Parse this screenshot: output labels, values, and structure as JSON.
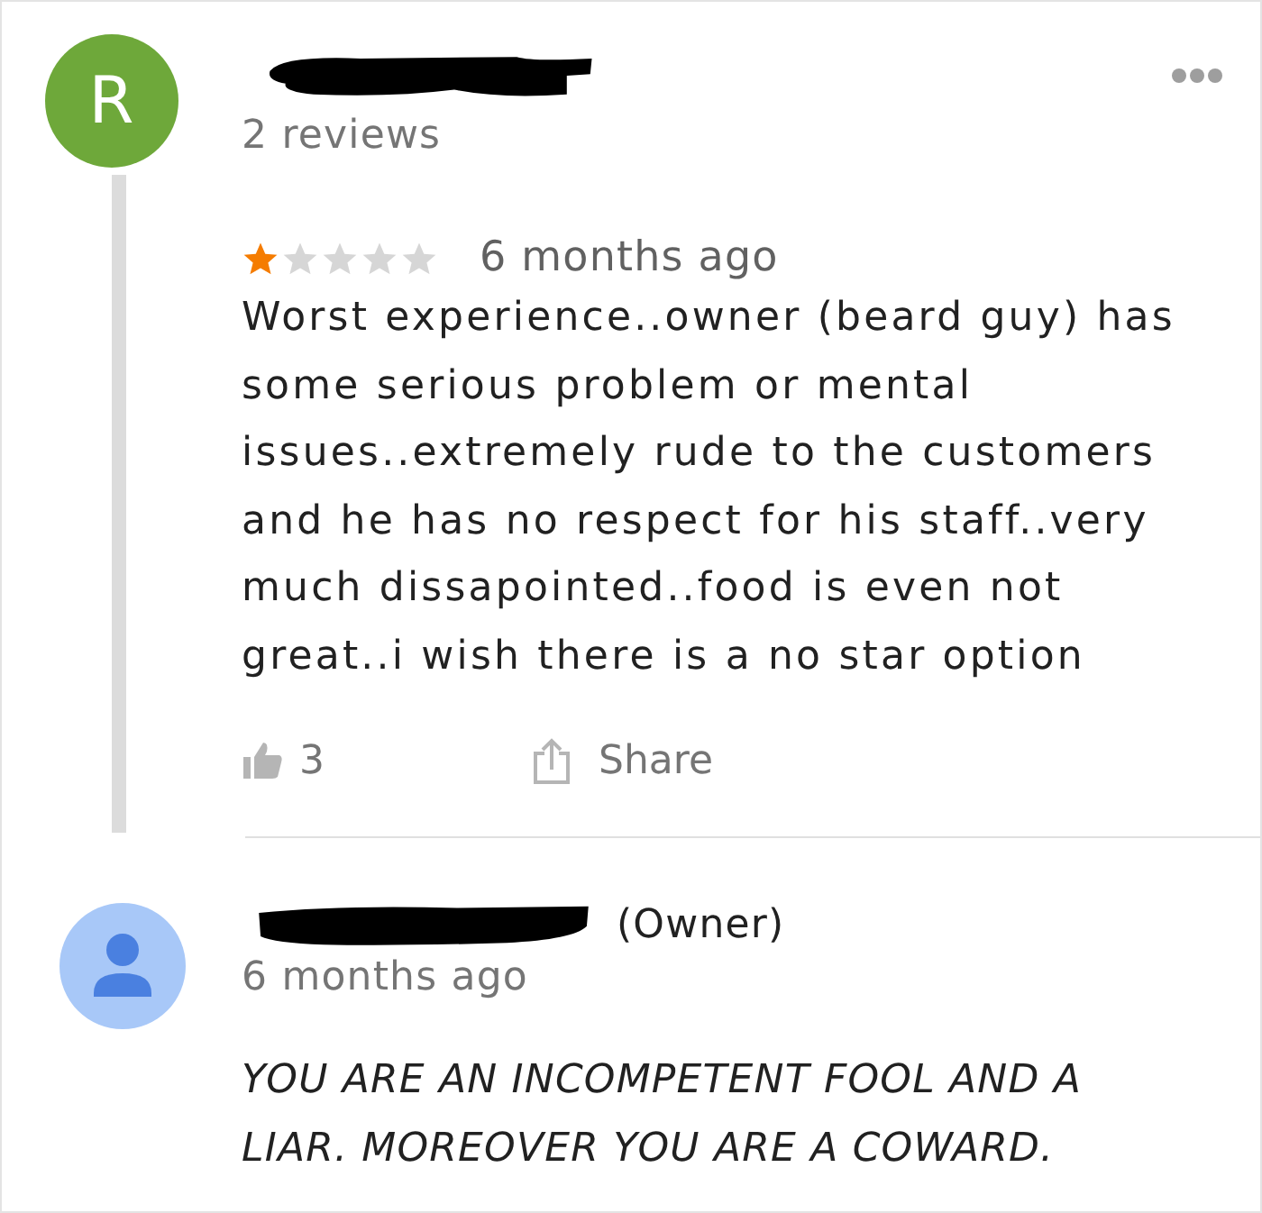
{
  "review": {
    "avatar_letter": "R",
    "author_redacted": true,
    "review_count": "2 reviews",
    "stars": 1,
    "time": "6 months ago",
    "text": "Worst experience..owner (beard guy) has some serious problem or mental issues..extremely rude to the customers and he has no respect for his staff..very much dissapointed..food is even not great..i wish there is a no star option",
    "likes": "3",
    "share_label": "Share"
  },
  "reply": {
    "author_redacted": true,
    "author_suffix": "(Owner)",
    "time": "6 months ago",
    "text": "YOU ARE AN INCOMPETENT FOOL AND A LIAR. MOREOVER YOU ARE A COWARD."
  }
}
